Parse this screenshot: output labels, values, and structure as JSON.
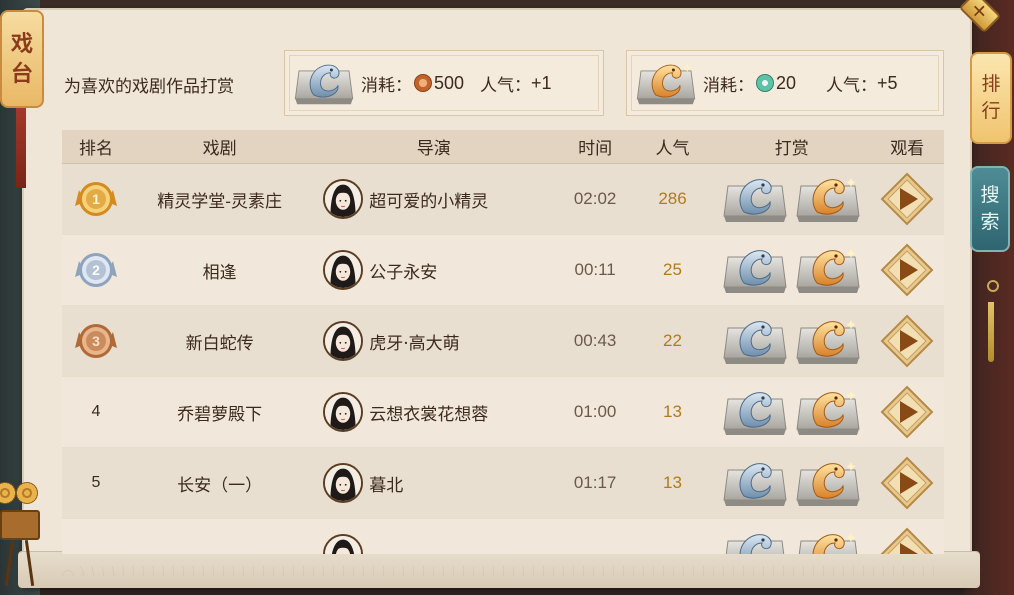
{
  "left_tab": {
    "label_1": "戏",
    "label_2": "台"
  },
  "right_tabs": {
    "rank": {
      "label_1": "排",
      "label_2": "行"
    },
    "search": {
      "label_1": "搜",
      "label_2": "索"
    }
  },
  "close_label": "✕",
  "header": {
    "prompt": "为喜欢的戏剧作品打赏",
    "tip_silver": {
      "cost_label": "消耗：",
      "cost": "500",
      "pop_label": "人气：",
      "pop": "+1",
      "currency_icon": "copper-coin-icon"
    },
    "tip_gold": {
      "cost_label": "消耗：",
      "cost": "20",
      "pop_label": "人气：",
      "pop": "+5",
      "currency_icon": "jade-coin-icon"
    }
  },
  "table": {
    "headers": {
      "rank": "排名",
      "play": "戏剧",
      "director": "导演",
      "time": "时间",
      "popularity": "人气",
      "tip": "打赏",
      "watch": "观看"
    },
    "rows": [
      {
        "rank": "1",
        "play": "精灵学堂-灵素庄",
        "director": "超可爱的小精灵",
        "time": "02:02",
        "popularity": "286"
      },
      {
        "rank": "2",
        "play": "相逢",
        "director": "公子永安",
        "time": "00:11",
        "popularity": "25"
      },
      {
        "rank": "3",
        "play": "新白蛇传",
        "director": "虎牙·高大萌",
        "time": "00:43",
        "popularity": "22"
      },
      {
        "rank": "4",
        "play": "乔碧萝殿下",
        "director": "云想衣裳花想蓉",
        "time": "01:00",
        "popularity": "13"
      },
      {
        "rank": "5",
        "play": "长安（一）",
        "director": "暮北",
        "time": "01:17",
        "popularity": "13"
      }
    ]
  },
  "colors": {
    "gold": "#e9b34c",
    "silver": "#9fb3c9",
    "bronze": "#c98a55",
    "popularity": "#b07a1e"
  }
}
